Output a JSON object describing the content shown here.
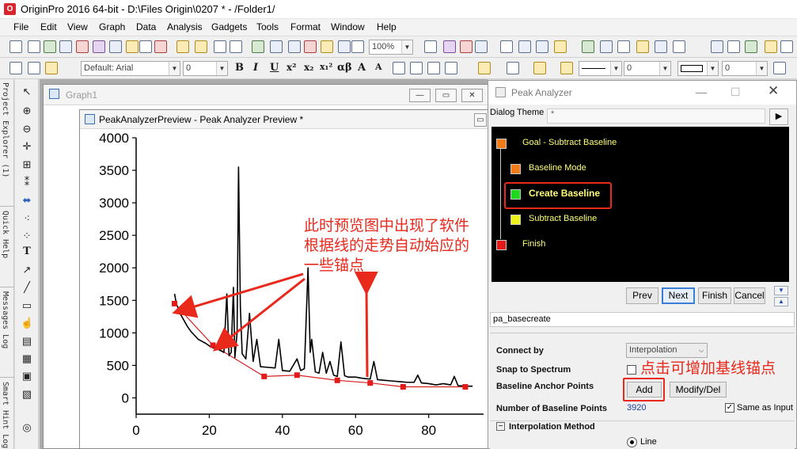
{
  "app": {
    "title": "OriginPro 2016 64-bit - D:\\Files Origin\\0207 * - /Folder1/",
    "logo_glyph": "O"
  },
  "menu": [
    "File",
    "Edit",
    "View",
    "Graph",
    "Data",
    "Analysis",
    "Gadgets",
    "Tools",
    "Format",
    "Window",
    "Help"
  ],
  "toolbar": {
    "zoom_value": "100%",
    "theme_label": "Default: Arial",
    "font_size_value": "0",
    "text_styles": [
      "B",
      "I",
      "U",
      "x²",
      "x₂",
      "x₁²",
      "αβ",
      "A",
      "A"
    ],
    "line_size_value": "0",
    "color_value_1": "0",
    "color_value_2": "0"
  },
  "left_tabs": [
    "Project Explorer (1)",
    "Quick Help",
    "Messages Log",
    "Smart Hint Log"
  ],
  "graph1": {
    "title": "Graph1",
    "buttons": [
      "—",
      "▭",
      "✕"
    ]
  },
  "preview": {
    "title": "PeakAnalyzerPreview - Peak Analyzer Preview *",
    "close": "▭"
  },
  "chart_data": {
    "type": "line",
    "x_ticks": [
      "0",
      "20",
      "40",
      "60",
      "80"
    ],
    "y_ticks": [
      "0",
      "500",
      "1000",
      "1500",
      "2000",
      "2500",
      "3000",
      "3500",
      "4000"
    ],
    "xlim": [
      0,
      95
    ],
    "ylim": [
      -250,
      4000
    ],
    "series": [
      {
        "points": [
          [
            10.5,
            1600
          ],
          [
            11,
            1450
          ],
          [
            12,
            1300
          ],
          [
            13,
            1200
          ],
          [
            14,
            1100
          ],
          [
            15,
            1020
          ],
          [
            16,
            960
          ],
          [
            17,
            900
          ],
          [
            18,
            870
          ],
          [
            19,
            840
          ],
          [
            20,
            800
          ],
          [
            21,
            770
          ],
          [
            22,
            760
          ],
          [
            23,
            730
          ],
          [
            24,
            700
          ],
          [
            24.8,
            1600
          ],
          [
            25.4,
            650
          ],
          [
            26,
            700
          ],
          [
            26.6,
            1700
          ],
          [
            27,
            620
          ],
          [
            27.6,
            1000
          ],
          [
            28,
            3550
          ],
          [
            28.5,
            1400
          ],
          [
            29,
            680
          ],
          [
            30,
            600
          ],
          [
            31,
            1300
          ],
          [
            32,
            560
          ],
          [
            33,
            900
          ],
          [
            34,
            480
          ],
          [
            36,
            470
          ],
          [
            38,
            460
          ],
          [
            39,
            900
          ],
          [
            40,
            420
          ],
          [
            42,
            410
          ],
          [
            44,
            600
          ],
          [
            45,
            420
          ],
          [
            46,
            450
          ],
          [
            47,
            2000
          ],
          [
            47.6,
            700
          ],
          [
            48,
            900
          ],
          [
            49,
            400
          ],
          [
            50,
            380
          ],
          [
            51,
            700
          ],
          [
            52,
            380
          ],
          [
            53,
            560
          ],
          [
            54,
            350
          ],
          [
            55,
            330
          ],
          [
            56,
            860
          ],
          [
            57,
            340
          ],
          [
            58,
            320
          ],
          [
            60,
            320
          ],
          [
            62,
            300
          ],
          [
            64,
            290
          ],
          [
            65,
            560
          ],
          [
            66,
            280
          ],
          [
            68,
            270
          ],
          [
            70,
            260
          ],
          [
            72,
            250
          ],
          [
            74,
            240
          ],
          [
            76,
            240
          ],
          [
            77,
            350
          ],
          [
            78,
            230
          ],
          [
            80,
            220
          ],
          [
            82,
            200
          ],
          [
            84,
            220
          ],
          [
            86,
            200
          ],
          [
            87,
            330
          ],
          [
            88,
            190
          ],
          [
            90,
            180
          ],
          [
            92,
            180
          ]
        ]
      }
    ],
    "baseline": {
      "anchors": [
        [
          10.5,
          1450
        ],
        [
          21,
          810
        ],
        [
          35,
          330
        ],
        [
          44,
          350
        ],
        [
          55,
          270
        ],
        [
          64,
          230
        ],
        [
          73,
          170
        ],
        [
          90,
          170
        ]
      ]
    }
  },
  "annotations": {
    "preview_note": [
      "此时预览图中出现了软件",
      "根据线的走势自动始应的",
      "一些锚点"
    ],
    "add_note": "点击可增加基线锚点"
  },
  "peak_analyzer": {
    "title": "Peak Analyzer",
    "dialog_theme_label": "Dialog Theme",
    "dialog_theme_value": "*",
    "tree": [
      {
        "label": "Goal - Subtract Baseline",
        "color": "#f07d1a"
      },
      {
        "label": "Baseline Mode",
        "color": "#f07d1a"
      },
      {
        "label": "Create Baseline",
        "color": "#1fd81f"
      },
      {
        "label": "Subtract Baseline",
        "color": "#f0f01a"
      },
      {
        "label": "Finish",
        "color": "#e21a1a"
      }
    ],
    "nav_buttons": [
      "Prev",
      "Next",
      "Finish",
      "Cancel"
    ],
    "theme_name": "pa_basecreate",
    "connect_by_label": "Connect by",
    "connect_by_value": "Interpolation",
    "snap_label": "Snap to Spectrum",
    "anchor_label": "Baseline Anchor Points",
    "add_label": "Add",
    "modify_label": "Modify/Del",
    "num_points_label": "Number of Baseline Points",
    "num_points_value": "3920",
    "same_as_input_label": "Same as Input",
    "interp_section_label": "Interpolation Method",
    "interp_line_label": "Line"
  }
}
